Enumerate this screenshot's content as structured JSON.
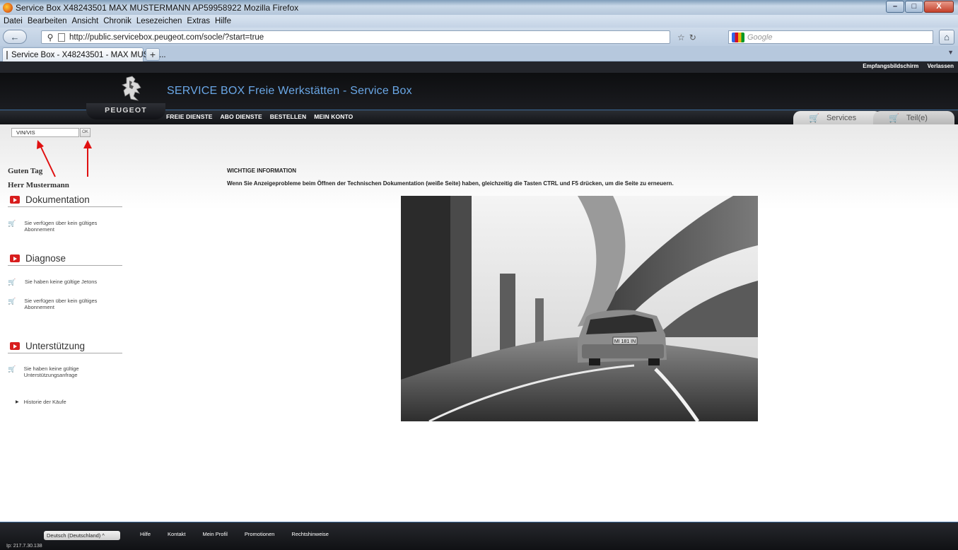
{
  "window": {
    "title": "Service Box  X48243501   MAX MUSTERMANN   AP59958922   Mozilla Firefox",
    "controls": [
      "–",
      "□",
      "X"
    ]
  },
  "menubar": [
    "Datei",
    "Bearbeiten",
    "Ansicht",
    "Chronik",
    "Lesezeichen",
    "Extras",
    "Hilfe"
  ],
  "navbar": {
    "url": "http://public.servicebox.peugeot.com/socle/?start=true",
    "search_placeholder": "Google"
  },
  "tabs": {
    "active_label": "Service Box - X48243501 - MAX MUSTE...",
    "new_tab": "+"
  },
  "site": {
    "top_links": [
      "Empfangsbildschirm",
      "Verlassen"
    ],
    "brand_name": "PEUGEOT",
    "title": "SERVICE BOX Freie Werkstätten - Service Box",
    "menu": [
      "FREIE DIENSTE",
      "ABO DIENSTE",
      "BESTELLEN",
      "MEIN KONTO"
    ],
    "main_tabs": [
      "Services",
      "Teil(e)"
    ]
  },
  "vin": {
    "value": "VIN/VIS",
    "ok_label": "OK"
  },
  "sidebar": {
    "greeting": "Guten Tag",
    "user_name": "Herr Mustermann",
    "sections": [
      {
        "title": "Dokumentation",
        "items": [
          "Sie verfügen über kein gültiges Abonnement"
        ]
      },
      {
        "title": "Diagnose",
        "items": [
          "Sie haben keine gültige Jetons",
          "Sie verfügen über kein gültiges Abonnement"
        ]
      },
      {
        "title": "Unterstützung",
        "items": [
          "Sie haben keine gültige Unterstützungsanfrage"
        ]
      }
    ],
    "history_link": "Historie der Käufe"
  },
  "main": {
    "info_title": "WICHTIGE INFORMATION",
    "info_text": "Wenn Sie Anzeigeprobleme beim Öffnen der Technischen Dokumentation (weiße Seite) haben, gleichzeitig die Tasten CTRL und F5 drücken, um die Seite zu erneuern.",
    "plate_text": "MI 181 IN"
  },
  "footer": {
    "language": "Deutsch (Deutschland)",
    "links": [
      "Hilfe",
      "Kontakt",
      "Mein Profil",
      "Promotionen",
      "Rechtshinweise"
    ],
    "ip": "Ip: 217.7.30.138"
  },
  "colors": {
    "brand_blue": "#6aa7e6",
    "header_dark": "#0d0e10",
    "section_red": "#d81e1e",
    "arrow_red": "#e01010"
  }
}
